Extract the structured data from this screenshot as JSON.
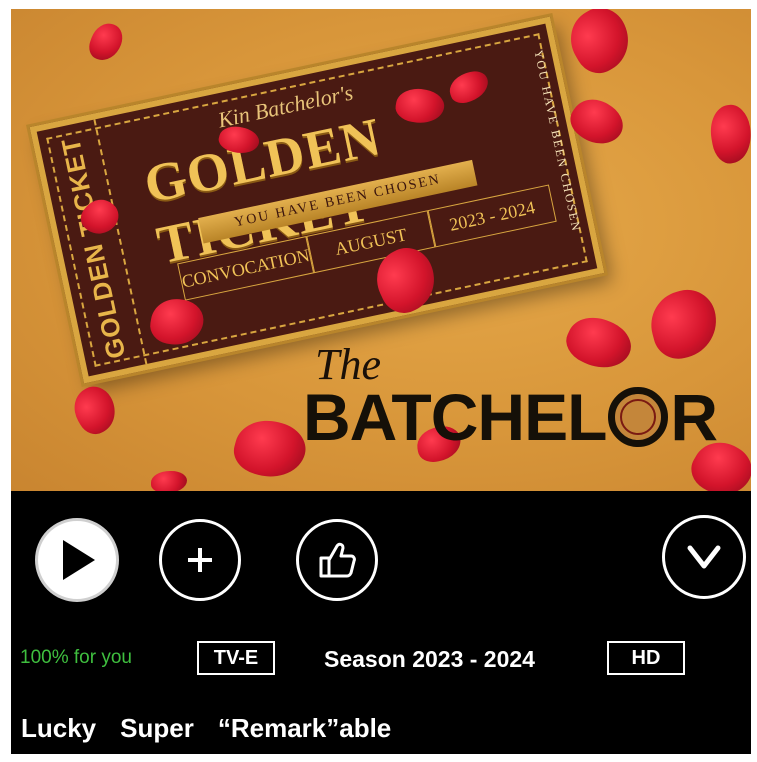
{
  "poster": {
    "ticket_script": "Kin Batchelor's",
    "ticket_title": "GOLDEN TICKET",
    "ticket_side": "GOLDEN TICKET",
    "ticket_banner": "YOU HAVE BEEN CHOSEN",
    "ticket_right": "YOU HAVE BEEN CHOSEN",
    "ticket_event": "CONVOCATION",
    "ticket_day": "AUGUST",
    "ticket_year": "2023 - 2024",
    "brand_the": "The",
    "brand_part1": "BATCHEL",
    "brand_part2": "R"
  },
  "actions": {
    "play_icon": "play-icon",
    "add_icon": "plus-icon",
    "like_icon": "thumbs-up-icon",
    "more_icon": "chevron-down-icon"
  },
  "meta": {
    "match": "100% for you",
    "rating": "TV-E",
    "season": "Season 2023 - 2024",
    "quality": "HD"
  },
  "tags": [
    "Lucky",
    "Super",
    "“Remark”able"
  ],
  "colors": {
    "match_green": "#3fbf3f",
    "panel_bg": "#000000",
    "poster_gold": "#d8963a",
    "petal_red": "#d3142b"
  }
}
